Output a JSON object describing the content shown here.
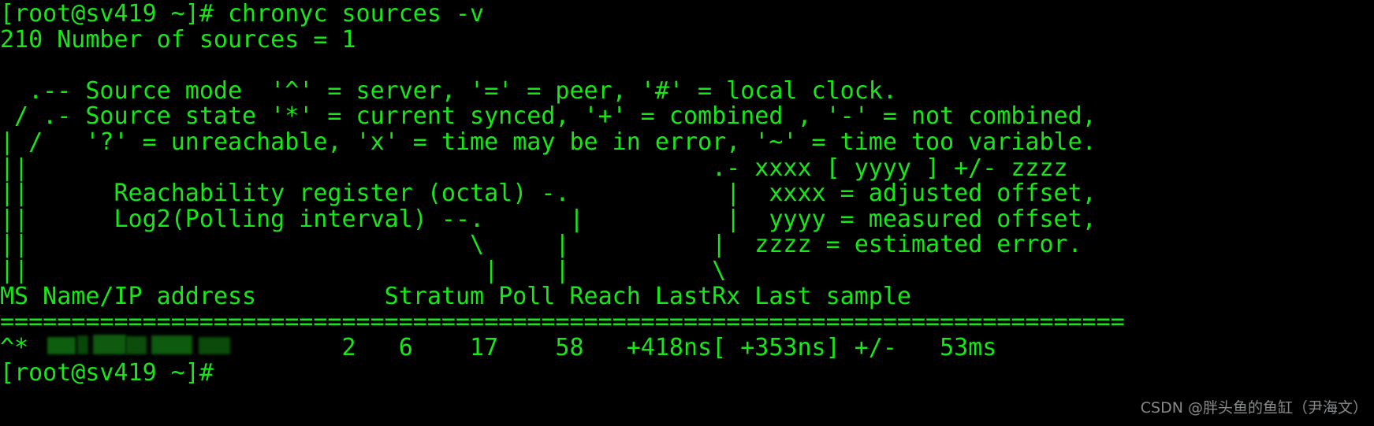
{
  "terminal": {
    "theme": {
      "background": "#000000",
      "foreground": "#19e619",
      "redaction": "#0d5a0d",
      "watermark_color": "#9ea0a3"
    },
    "prompt": "[root@sv419 ~]#",
    "command": "chronyc sources -v",
    "lines": {
      "l01": "[root@sv419 ~]# chronyc sources -v",
      "l02": "210 Number of sources = 1",
      "l03": "",
      "l04": "  .-- Source mode  '^' = server, '=' = peer, '#' = local clock.",
      "l05": " / .- Source state '*' = current synced, '+' = combined , '-' = not combined,",
      "l06": "| /   '?' = unreachable, 'x' = time may be in error, '~' = time too variable.",
      "l07": "||                                                .- xxxx [ yyyy ] +/- zzzz",
      "l08": "||      Reachability register (octal) -.           |  xxxx = adjusted offset,",
      "l09": "||      Log2(Polling interval) --.      |          |  yyyy = measured offset,",
      "l10": "||                               \\     |          |  zzzz = estimated error.",
      "l11": "||                                |    |          \\",
      "l12": "MS Name/IP address         Stratum Poll Reach LastRx Last sample",
      "l13": "===============================================================================",
      "l14_prefix": "^* ",
      "l14_redacted_host": "",
      "l14_values": "                     2   6    17    58   +418ns[ +353ns] +/-   53ms",
      "l15": "[root@sv419 ~]#"
    },
    "table": {
      "headers": [
        "MS",
        "Name/IP address",
        "Stratum",
        "Poll",
        "Reach",
        "LastRx",
        "Last sample"
      ],
      "rows": [
        {
          "ms": "^*",
          "name": "",
          "name_redacted": true,
          "stratum": "2",
          "poll": "6",
          "reach": "17",
          "lastrx": "58",
          "last_sample": "+418ns[ +353ns] +/-   53ms"
        }
      ]
    },
    "legend": {
      "source_mode": [
        "'^' = server",
        "'=' = peer",
        "'#' = local clock."
      ],
      "source_state": [
        "'*' = current synced",
        "'+' = combined",
        "'-' = not combined",
        "'?' = unreachable",
        "'x' = time may be in error",
        "'~' = time too variable."
      ],
      "sample_format": ".- xxxx [ yyyy ] +/- zzzz",
      "sample_fields": [
        "xxxx = adjusted offset,",
        "yyyy = measured offset,",
        "zzzz = estimated error."
      ],
      "annotations": [
        "Reachability register (octal) -.",
        "Log2(Polling interval) --."
      ]
    },
    "status_line": "210 Number of sources = 1",
    "source_count": "1"
  },
  "watermark": "CSDN @胖头鱼的鱼缸（尹海文）"
}
